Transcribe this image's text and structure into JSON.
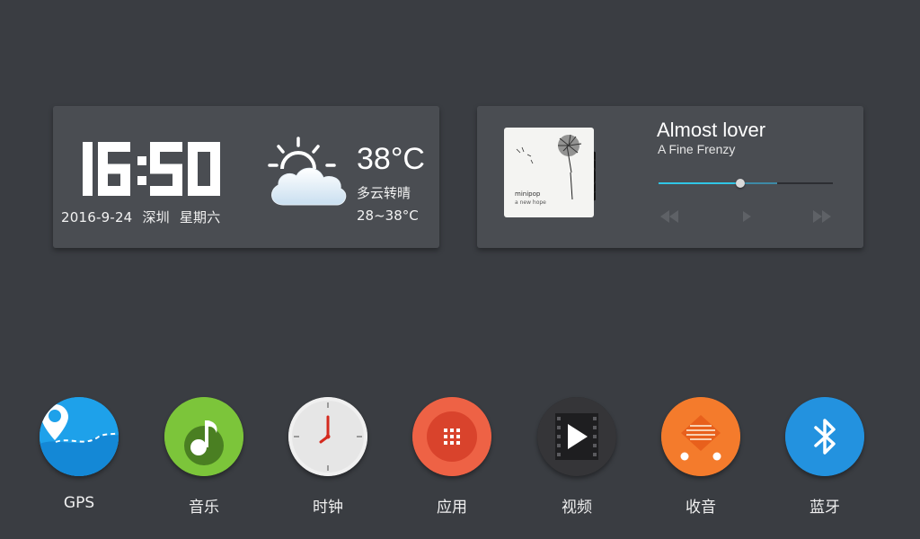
{
  "weather_widget": {
    "time": "16:50",
    "date": "2016-9-24",
    "city": "深圳",
    "weekday": "星期六",
    "temperature": "38°C",
    "condition": "多云转晴",
    "temp_range": "28~38°C",
    "icon": "partly-cloudy-icon"
  },
  "music_widget": {
    "song_title": "Almost lover",
    "artist": "A Fine Frenzy",
    "album_cover": {
      "text_line1": "minipop",
      "text_line2": "a new hope"
    },
    "progress": 0.47,
    "buffered": 0.68,
    "controls": {
      "prev_icon": "rewind-icon",
      "play_icon": "play-icon",
      "next_icon": "fast-forward-icon"
    }
  },
  "dock": {
    "apps": [
      {
        "label": "GPS",
        "icon": "gps-map-icon",
        "color": "#1e9be8"
      },
      {
        "label": "音乐",
        "icon": "music-note-icon",
        "color": "#7cc53a"
      },
      {
        "label": "时钟",
        "icon": "clock-icon",
        "color": "#f2f2f2"
      },
      {
        "label": "应用",
        "icon": "app-grid-icon",
        "color": "#e8553c"
      },
      {
        "label": "视频",
        "icon": "video-play-icon",
        "color": "#2c2c2e"
      },
      {
        "label": "收音",
        "icon": "radio-icon",
        "color": "#f07a2a"
      },
      {
        "label": "蓝牙",
        "icon": "bluetooth-icon",
        "color": "#1f8fdc"
      }
    ]
  },
  "colors": {
    "background": "#3a3d42",
    "card": "#4a4d52",
    "accent": "#30c6e6"
  }
}
